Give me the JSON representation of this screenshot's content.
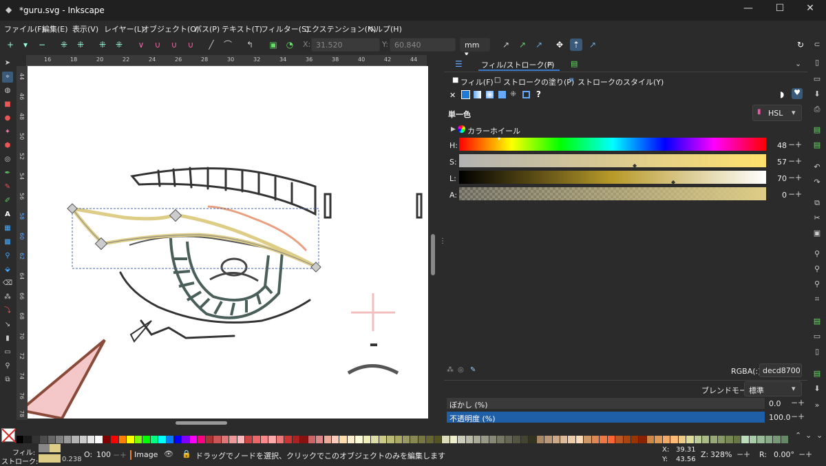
{
  "window": {
    "title": "*guru.svg - Inkscape",
    "minimize": "—",
    "maximize": "☐",
    "close": "✕"
  },
  "menu": [
    "ファイル(F)",
    "編集(E)",
    "表示(V)",
    "レイヤー(L)",
    "オブジェクト(O)",
    "パス(P)",
    "テキスト(T)",
    "フィルター(S)",
    "エクステンション(N)",
    "ヘルプ(H)"
  ],
  "toolbar": {
    "x_label": "X:",
    "x_value": "31.520",
    "y_label": "Y:",
    "y_value": "60.840",
    "unit": "mm"
  },
  "ruler": {
    "h_ticks": [
      "16",
      "18",
      "20",
      "22",
      "24",
      "26",
      "28",
      "30",
      "32",
      "34",
      "36",
      "38",
      "40",
      "42",
      "44"
    ],
    "v_ticks": [
      "44",
      "46",
      "48",
      "50",
      "52",
      "54",
      "56",
      "58",
      "60",
      "62",
      "64",
      "66",
      "68",
      "70",
      "72",
      "74",
      "76",
      "78"
    ]
  },
  "panel": {
    "tab_fillstroke": "フィル/ストローク(F)",
    "tab_close": "×",
    "subtabs": [
      "フィル(F)",
      "ストロークの塗り(P)",
      "ストロークのスタイル(Y)"
    ],
    "fill_type": "単一色",
    "color_mode": "HSL",
    "color_wheel": "カラーホイール",
    "sliders": [
      {
        "label": "H:",
        "value": "48"
      },
      {
        "label": "S:",
        "value": "57"
      },
      {
        "label": "L:",
        "value": "70"
      },
      {
        "label": "A:",
        "value": "0"
      }
    ],
    "rgba_label": "RGBA(:)",
    "rgba_value": "decd8700",
    "blend_label": "ブレンドモード:",
    "blend_value": "標準",
    "blur_label": "ぼかし (%)",
    "blur_value": "0.0",
    "opacity_label": "不透明度 (%)",
    "opacity_value": "100.0",
    "unknown": "?"
  },
  "status": {
    "fill_label": "フィル:",
    "stroke_label": "ストローク:",
    "stroke_width": "0.238",
    "o_label": "O:",
    "o_value": "100",
    "layer": "Image",
    "message": "ドラッグでノードを選択、クリックでこのオブジェクトのみを編集します",
    "x_label": "X:",
    "x_value": "39.31",
    "y_label": "Y:",
    "y_value": "43.56",
    "z_label": "Z:",
    "zoom": "328%",
    "r_label": "R:",
    "rotation": "0.00°"
  },
  "colors": {
    "accent": "#1e5fa8",
    "selected_fill": "#decd87",
    "bg": "#2b2b2b"
  }
}
